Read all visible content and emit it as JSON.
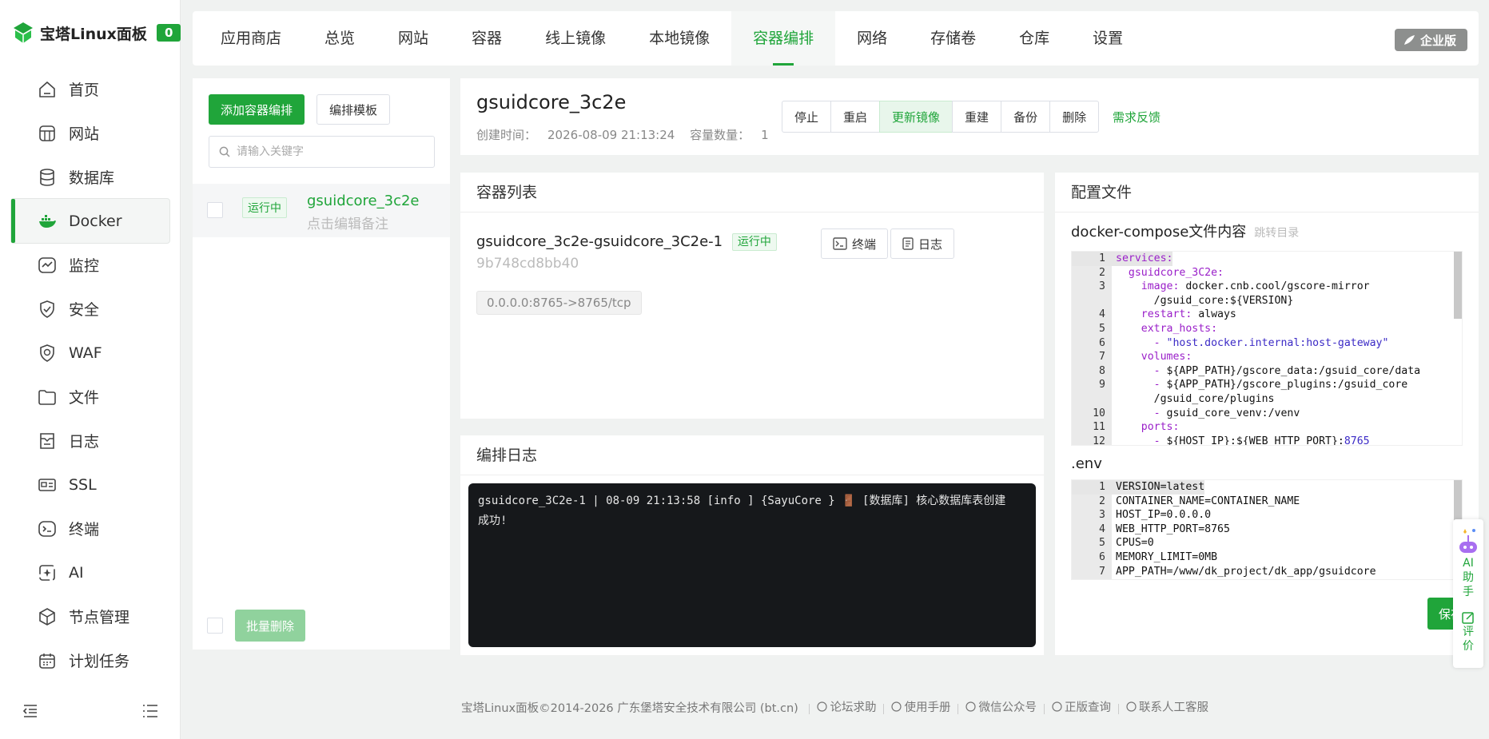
{
  "brand": {
    "name": "宝塔Linux面板",
    "badge": "0",
    "accent": "#20a53a"
  },
  "sidebar": {
    "items": [
      {
        "label": "首页",
        "icon": "home-icon"
      },
      {
        "label": "网站",
        "icon": "globe-icon"
      },
      {
        "label": "数据库",
        "icon": "database-icon"
      },
      {
        "label": "Docker",
        "icon": "docker-icon",
        "active": true
      },
      {
        "label": "监控",
        "icon": "monitor-icon"
      },
      {
        "label": "安全",
        "icon": "shield-icon"
      },
      {
        "label": "WAF",
        "icon": "waf-icon"
      },
      {
        "label": "文件",
        "icon": "folder-icon"
      },
      {
        "label": "日志",
        "icon": "log-icon"
      },
      {
        "label": "SSL",
        "icon": "ssl-icon"
      },
      {
        "label": "终端",
        "icon": "terminal-icon"
      },
      {
        "label": "AI",
        "icon": "ai-icon"
      },
      {
        "label": "节点管理",
        "icon": "node-icon"
      },
      {
        "label": "计划任务",
        "icon": "calendar-icon"
      }
    ]
  },
  "topnav": {
    "tabs": [
      "应用商店",
      "总览",
      "网站",
      "容器",
      "线上镜像",
      "本地镜像",
      "容器编排",
      "网络",
      "存储卷",
      "仓库",
      "设置"
    ],
    "active_index": 6,
    "enterprise_label": "企业版"
  },
  "left": {
    "add_button": "添加容器编排",
    "template_button": "编排模板",
    "search_placeholder": "请输入关键字",
    "row": {
      "status": "运行中",
      "name": "gsuidcore_3c2e",
      "note": "点击编辑备注"
    },
    "batch_delete": "批量删除"
  },
  "project": {
    "title": "gsuidcore_3c2e",
    "created_label": "创建时间：",
    "created_value": "2026-08-09 21:13:24",
    "count_label": "容量数量：",
    "count_value": "1",
    "actions": [
      "停止",
      "重启",
      "更新镜像",
      "重建",
      "备份",
      "删除"
    ],
    "feedback": "需求反馈"
  },
  "containers": {
    "header": "容器列表",
    "name": "gsuidcore_3c2e-gsuidcore_3C2e-1",
    "status": "运行中",
    "id": "9b748cd8bb40",
    "port": "0.0.0.0:8765->8765/tcp",
    "terminal_button": "终端",
    "log_button": "日志"
  },
  "logs": {
    "header": "编排日志",
    "line1": "gsuidcore_3C2e-1 | 08-09 21:13:58 [info ] {SayuCore } 🚪 [数据库] 核心数据库表创建",
    "line2": "成功!"
  },
  "config": {
    "header": "配置文件",
    "compose_title": "docker-compose文件内容",
    "compose_link": "跳转目录",
    "compose_lines": [
      {
        "n": "1",
        "k": "services:",
        "v": "",
        "indent": ""
      },
      {
        "n": "2",
        "k": "gsuidcore_3C2e:",
        "v": "",
        "indent": "  "
      },
      {
        "n": "3",
        "k": "image:",
        "v": " docker.cnb.cool/gscore-mirror",
        "indent": "    "
      },
      {
        "n": "",
        "k": "",
        "v": "/gsuid_core:${VERSION}",
        "indent": "      "
      },
      {
        "n": "4",
        "k": "restart:",
        "v": " always",
        "indent": "    "
      },
      {
        "n": "5",
        "k": "extra_hosts:",
        "v": "",
        "indent": "    "
      },
      {
        "n": "6",
        "k": "- ",
        "v": "\"host.docker.internal:host-gateway\"",
        "indent": "      ",
        "str": true
      },
      {
        "n": "7",
        "k": "volumes:",
        "v": "",
        "indent": "    "
      },
      {
        "n": "8",
        "k": "- ",
        "v": "${APP_PATH}/gscore_data:/gsuid_core/data",
        "indent": "      "
      },
      {
        "n": "9",
        "k": "- ",
        "v": "${APP_PATH}/gscore_plugins:/gsuid_core",
        "indent": "      "
      },
      {
        "n": "",
        "k": "",
        "v": "/gsuid_core/plugins",
        "indent": "      "
      },
      {
        "n": "10",
        "k": "- ",
        "v": "gsuid_core_venv:/venv",
        "indent": "      "
      },
      {
        "n": "11",
        "k": "ports:",
        "v": "",
        "indent": "    "
      },
      {
        "n": "12",
        "k": "- ",
        "v": "${HOST_IP}:${WEB_HTTP_PORT}:8765",
        "indent": "      ",
        "portnum": true
      }
    ],
    "env_title": ".env",
    "env_lines": [
      {
        "n": "1",
        "v": "VERSION=latest"
      },
      {
        "n": "2",
        "v": "CONTAINER_NAME=CONTAINER_NAME"
      },
      {
        "n": "3",
        "v": "HOST_IP=0.0.0.0"
      },
      {
        "n": "4",
        "v": "WEB_HTTP_PORT=8765"
      },
      {
        "n": "5",
        "v": "CPUS=0"
      },
      {
        "n": "6",
        "v": "MEMORY_LIMIT=0MB"
      },
      {
        "n": "7",
        "v": "APP_PATH=/www/dk_project/dk_app/gsuidcore"
      }
    ],
    "save_button": "保存"
  },
  "assistant": {
    "ai_label": "AI助手",
    "rate_label": "评价"
  },
  "footer": {
    "copyright": "宝塔Linux面板©2014-2026 广东堡塔安全技术有限公司 (bt.cn)",
    "links": [
      "论坛求助",
      "使用手册",
      "微信公众号",
      "正版查询",
      "联系人工客服"
    ]
  }
}
